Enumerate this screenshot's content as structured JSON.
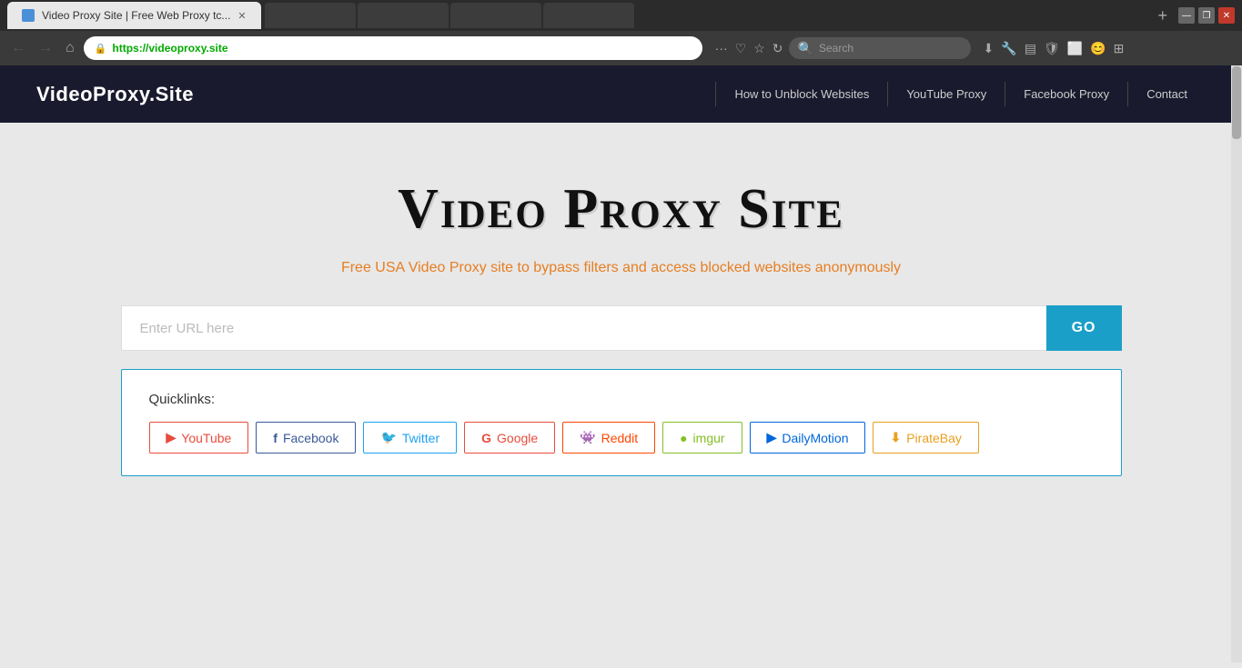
{
  "browser": {
    "tab_title": "Video Proxy Site | Free Web Proxy tc...",
    "tab_new_label": "+",
    "address": "https://videoproxy.site",
    "address_display": "https://videoproxy.site",
    "address_protocol": "https://",
    "address_domain": "videoproxy.site",
    "search_placeholder": "Search",
    "window_minimize": "—",
    "window_restore": "❐",
    "window_close": "✕"
  },
  "site": {
    "logo": "VideoProxy.Site",
    "nav": {
      "items": [
        {
          "label": "How to Unblock Websites"
        },
        {
          "label": "YouTube Proxy"
        },
        {
          "label": "Facebook Proxy"
        },
        {
          "label": "Contact"
        }
      ]
    },
    "hero": {
      "title": "Video Proxy Site",
      "subtitle": "Free USA Video Proxy site to bypass filters and access blocked websites anonymously"
    },
    "url_input": {
      "placeholder": "Enter URL here",
      "button_label": "GO"
    },
    "quicklinks": {
      "label": "Quicklinks:",
      "buttons": [
        {
          "name": "YouTube",
          "icon": "▶",
          "class": "youtube"
        },
        {
          "name": "Facebook",
          "icon": "f",
          "class": "facebook"
        },
        {
          "name": "Twitter",
          "icon": "🐦",
          "class": "twitter"
        },
        {
          "name": "Google",
          "icon": "G",
          "class": "google"
        },
        {
          "name": "Reddit",
          "icon": "👾",
          "class": "reddit"
        },
        {
          "name": "imgur",
          "icon": "●",
          "class": "imgur"
        },
        {
          "name": "DailyMotion",
          "icon": "▶",
          "class": "dailymotion"
        },
        {
          "name": "PirateBay",
          "icon": "⬇",
          "class": "piratebay"
        }
      ]
    }
  }
}
